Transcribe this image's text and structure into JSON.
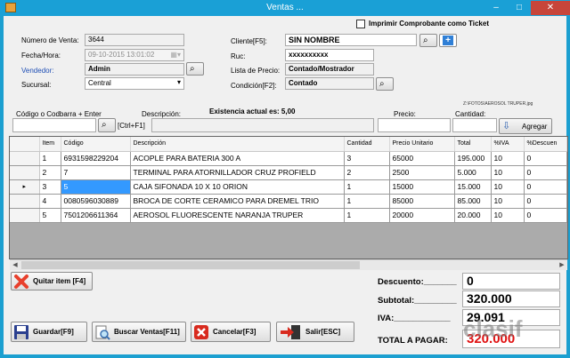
{
  "window": {
    "title": "Ventas ...",
    "minimize": "–",
    "maximize": "□",
    "close": "✕"
  },
  "ticket_checkbox_label": "Imprimir Comprobante como Ticket",
  "header": {
    "numero_venta_label": "Número de Venta:",
    "numero_venta_value": "3644",
    "fecha_label": "Fecha/Hora:",
    "fecha_value": "09-10-2015 13:01:02",
    "vendedor_label": "Vendedor:",
    "vendedor_value": "Admin",
    "sucursal_label": "Sucursal:",
    "sucursal_value": "Central",
    "cliente_label": "Cliente[F5]:",
    "cliente_value": "SIN NOMBRE",
    "ruc_label": "Ruc:",
    "ruc_value": "xxxxxxxxxx",
    "lista_precio_label": "Lista de Precio:",
    "lista_precio_value": "Contado/Mostrador",
    "condicion_label": "Condición[F2]:",
    "condicion_value": "Contado"
  },
  "entry": {
    "codigo_label": "Código o Codbarra + Enter",
    "ctrl_f1_label": "[Ctrl+F1]",
    "descripcion_label": "Descripción:",
    "existencia_label": "Existencia actual es: 5,00",
    "precio_label": "Precio:",
    "cantidad_label": "Cantidad:",
    "image_path": "Z:\\FOTOS\\AEROSOL TRUPER.jpg",
    "agregar_label": "Agregar"
  },
  "grid": {
    "columns": [
      "Item",
      "Código",
      "Descripción",
      "Cantidad",
      "Precio Unitario",
      "Total",
      "%IVA",
      "%Descuen"
    ],
    "current_row_marker": "▸",
    "rows": [
      {
        "item": "1",
        "codigo": "6931598229204",
        "descripcion": "ACOPLE PARA BATERIA 300 A",
        "cantidad": "3",
        "precio": "65000",
        "total": "195.000",
        "iva": "10",
        "descuento": "0"
      },
      {
        "item": "2",
        "codigo": "7",
        "descripcion": "TERMINAL PARA ATORNILLADOR CRUZ PROFIELD",
        "cantidad": "2",
        "precio": "2500",
        "total": "5.000",
        "iva": "10",
        "descuento": "0"
      },
      {
        "item": "3",
        "codigo": "5",
        "descripcion": "CAJA SIFONADA 10 X 10 ORION",
        "cantidad": "1",
        "precio": "15000",
        "total": "15.000",
        "iva": "10",
        "descuento": "0"
      },
      {
        "item": "4",
        "codigo": "0080596030889",
        "descripcion": "BROCA DE CORTE CERAMICO PARA DREMEL TRIO",
        "cantidad": "1",
        "precio": "85000",
        "total": "85.000",
        "iva": "10",
        "descuento": "0"
      },
      {
        "item": "5",
        "codigo": "7501206611364",
        "descripcion": "AEROSOL FLUORESCENTE NARANJA TRUPER",
        "cantidad": "1",
        "precio": "20000",
        "total": "20.000",
        "iva": "10",
        "descuento": "0"
      }
    ]
  },
  "buttons": {
    "quitar_item": "Quitar item [F4]",
    "guardar": "Guardar[F9]",
    "buscar_ventas": "Buscar Ventas[F11]",
    "cancelar": "Cancelar[F3]",
    "salir": "Salir[ESC]"
  },
  "totals": {
    "descuento_label": "Descuento:_______",
    "descuento_value": "0",
    "subtotal_label": "Subtotal:_________",
    "subtotal_value": "320.000",
    "iva_label": "IVA:____________",
    "iva_value": "29.091",
    "total_label": "TOTAL A PAGAR:",
    "total_value": "320.000"
  },
  "watermark": "clasif",
  "colors": {
    "titlebar": "#1aa0d6",
    "selected_cell": "#3399ff",
    "total_value": "#e01010",
    "vendedor_label": "#1f4fb5"
  }
}
